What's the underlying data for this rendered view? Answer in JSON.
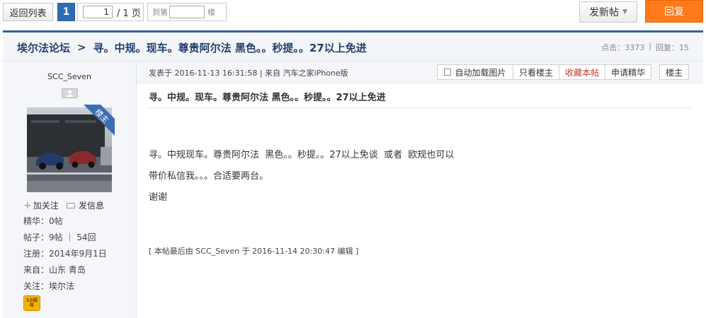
{
  "toolbar": {
    "back_label": "返回列表",
    "page_current": "1",
    "page_input_value": "1",
    "page_total": "/ 1 页",
    "goto_prefix": "到第",
    "goto_suffix": "楼",
    "new_post_label": "发新帖",
    "reply_label": "回复"
  },
  "header": {
    "forum_name": "埃尔法论坛",
    "separator": ">",
    "thread_title": "寻。中规。现车。尊贵阿尔法 黑色。。秒提。。27以上免进",
    "views_label": "点击：3373",
    "divider": "|",
    "replies_label": "回复：15"
  },
  "author": {
    "username": "SCC_Seven",
    "badge": "楼主",
    "follow_label": "加关注",
    "message_label": "发信息",
    "stats": [
      "精华：0帖",
      "帖子：9帖 ｜ 54回",
      "注册：2014年9月1日",
      "来自：山东 青岛",
      "关注：埃尔法"
    ],
    "medal_text": "10周年"
  },
  "post": {
    "meta": "发表于 2016-11-13 16:31:58 | 来自 汽车之家iPhone版",
    "auto_load_label": "自动加载图片",
    "only_author_label": "只看楼主",
    "favorite_label": "收藏本帖",
    "apply_elite_label": "申请精华",
    "floor_label": "楼主",
    "title": "寻。中规。现车。尊贵阿尔法 黑色。。秒提。。27以上免进",
    "lines": [
      "寻。中规现车。尊贵阿尔法  黑色。。秒提。。27以上免谈  或者  欧规也可以",
      "带价私信我。。。合适要两台。",
      "谢谢"
    ],
    "edit_note": "[ 本帖最后由 SCC_Seven 于 2016-11-14 20:30:47 编辑 ]"
  },
  "colors": {
    "accent": "#2f6ab4",
    "reply": "#ff7a1a",
    "favorite": "#c0392b"
  }
}
